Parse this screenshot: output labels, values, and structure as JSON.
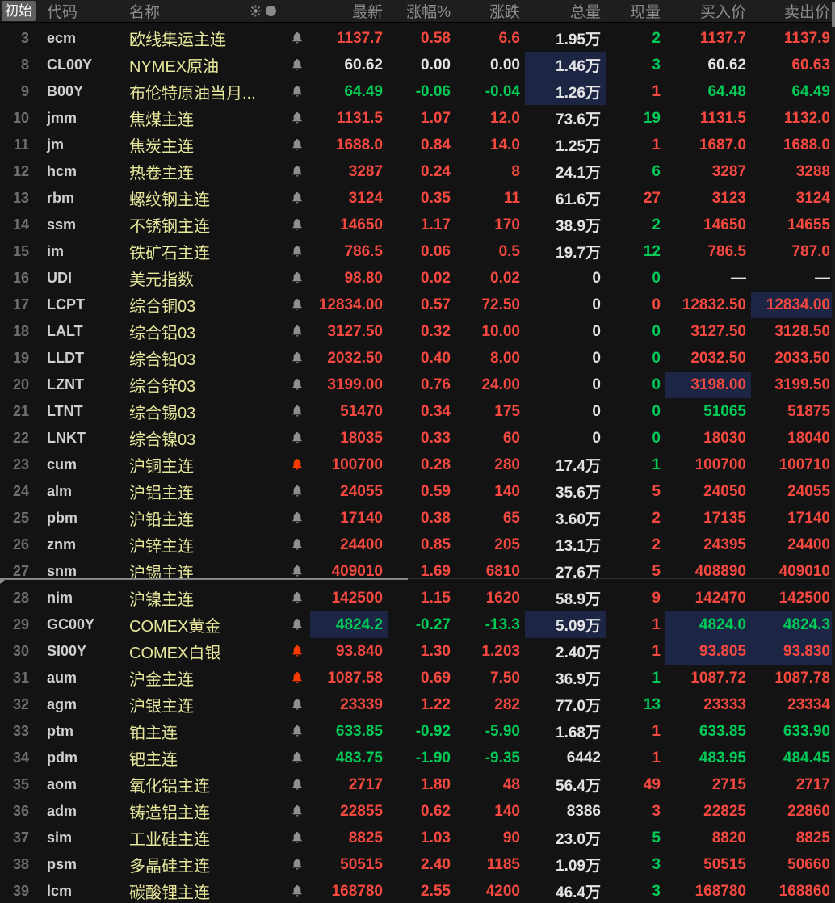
{
  "palette": {
    "red": "#f7493f",
    "green": "#00cb57",
    "white": "#e4e4e4",
    "yellow": "#e7e79c",
    "navy": "#1c2544",
    "bellgray": "#8f8f8f",
    "bellred": "#ff3a00",
    "rowbg": "#131313",
    "hdrbg": "#1e1e1e",
    "hdrtext": "#8c8c8c",
    "numgray": "#6f6f6f",
    "codegray": "#cfcfcf",
    "btnbg": "#5f5f5f"
  },
  "header": {
    "init_button": "初始",
    "code": "代码",
    "name": "名称",
    "last": "最新",
    "pct": "涨幅%",
    "chg": "涨跌",
    "vol": "总量",
    "cur": "现量",
    "bid": "买入价",
    "ask": "卖出价",
    "icons": [
      "sunburst-icon",
      "circle-icon"
    ]
  },
  "rows": [
    {
      "num": "3",
      "code": "ecm",
      "name": "欧线集运主连",
      "bell": "gray",
      "hl": [],
      "cells": [
        [
          "1137.7",
          "r"
        ],
        [
          "0.58",
          "r"
        ],
        [
          "6.6",
          "r"
        ],
        [
          "1.95万",
          "w"
        ],
        [
          "2",
          "g"
        ],
        [
          "1137.7",
          "r"
        ],
        [
          "1137.9",
          "r"
        ]
      ]
    },
    {
      "num": "8",
      "code": "CL00Y",
      "name": "NYMEX原油",
      "bell": "gray",
      "hl": [
        3
      ],
      "cells": [
        [
          "60.62",
          "w"
        ],
        [
          "0.00",
          "w"
        ],
        [
          "0.00",
          "w"
        ],
        [
          "1.46万",
          "w"
        ],
        [
          "3",
          "g"
        ],
        [
          "60.62",
          "w"
        ],
        [
          "60.63",
          "r"
        ]
      ]
    },
    {
      "num": "9",
      "code": "B00Y",
      "name": "布伦特原油当月...",
      "bell": "gray",
      "hl": [
        3
      ],
      "cells": [
        [
          "64.49",
          "g"
        ],
        [
          "-0.06",
          "g"
        ],
        [
          "-0.04",
          "g"
        ],
        [
          "1.26万",
          "w"
        ],
        [
          "1",
          "r"
        ],
        [
          "64.48",
          "g"
        ],
        [
          "64.49",
          "g"
        ]
      ]
    },
    {
      "num": "10",
      "code": "jmm",
      "name": "焦煤主连",
      "bell": "gray",
      "hl": [],
      "cells": [
        [
          "1131.5",
          "r"
        ],
        [
          "1.07",
          "r"
        ],
        [
          "12.0",
          "r"
        ],
        [
          "73.6万",
          "w"
        ],
        [
          "19",
          "g"
        ],
        [
          "1131.5",
          "r"
        ],
        [
          "1132.0",
          "r"
        ]
      ]
    },
    {
      "num": "11",
      "code": "jm",
      "name": "焦炭主连",
      "bell": "gray",
      "hl": [],
      "cells": [
        [
          "1688.0",
          "r"
        ],
        [
          "0.84",
          "r"
        ],
        [
          "14.0",
          "r"
        ],
        [
          "1.25万",
          "w"
        ],
        [
          "1",
          "r"
        ],
        [
          "1687.0",
          "r"
        ],
        [
          "1688.0",
          "r"
        ]
      ]
    },
    {
      "num": "12",
      "code": "hcm",
      "name": "热卷主连",
      "bell": "gray",
      "hl": [],
      "cells": [
        [
          "3287",
          "r"
        ],
        [
          "0.24",
          "r"
        ],
        [
          "8",
          "r"
        ],
        [
          "24.1万",
          "w"
        ],
        [
          "6",
          "g"
        ],
        [
          "3287",
          "r"
        ],
        [
          "3288",
          "r"
        ]
      ]
    },
    {
      "num": "13",
      "code": "rbm",
      "name": "螺纹钢主连",
      "bell": "gray",
      "hl": [],
      "cells": [
        [
          "3124",
          "r"
        ],
        [
          "0.35",
          "r"
        ],
        [
          "11",
          "r"
        ],
        [
          "61.6万",
          "w"
        ],
        [
          "27",
          "r"
        ],
        [
          "3123",
          "r"
        ],
        [
          "3124",
          "r"
        ]
      ]
    },
    {
      "num": "14",
      "code": "ssm",
      "name": "不锈钢主连",
      "bell": "gray",
      "hl": [],
      "cells": [
        [
          "14650",
          "r"
        ],
        [
          "1.17",
          "r"
        ],
        [
          "170",
          "r"
        ],
        [
          "38.9万",
          "w"
        ],
        [
          "2",
          "g"
        ],
        [
          "14650",
          "r"
        ],
        [
          "14655",
          "r"
        ]
      ]
    },
    {
      "num": "15",
      "code": "im",
      "name": "铁矿石主连",
      "bell": "gray",
      "hl": [],
      "cells": [
        [
          "786.5",
          "r"
        ],
        [
          "0.06",
          "r"
        ],
        [
          "0.5",
          "r"
        ],
        [
          "19.7万",
          "w"
        ],
        [
          "12",
          "g"
        ],
        [
          "786.5",
          "r"
        ],
        [
          "787.0",
          "r"
        ]
      ]
    },
    {
      "num": "16",
      "code": "UDI",
      "name": "美元指数",
      "bell": "gray",
      "hl": [],
      "cells": [
        [
          "98.80",
          "r"
        ],
        [
          "0.02",
          "r"
        ],
        [
          "0.02",
          "r"
        ],
        [
          "0",
          "w"
        ],
        [
          "0",
          "g"
        ],
        [
          "—",
          "w"
        ],
        [
          "—",
          "w"
        ]
      ]
    },
    {
      "num": "17",
      "code": "LCPT",
      "name": "综合铜03",
      "bell": "gray",
      "hl": [
        6
      ],
      "cells": [
        [
          "12834.00",
          "r"
        ],
        [
          "0.57",
          "r"
        ],
        [
          "72.50",
          "r"
        ],
        [
          "0",
          "w"
        ],
        [
          "0",
          "r"
        ],
        [
          "12832.50",
          "r"
        ],
        [
          "12834.00",
          "r"
        ]
      ]
    },
    {
      "num": "18",
      "code": "LALT",
      "name": "综合铝03",
      "bell": "gray",
      "hl": [],
      "cells": [
        [
          "3127.50",
          "r"
        ],
        [
          "0.32",
          "r"
        ],
        [
          "10.00",
          "r"
        ],
        [
          "0",
          "w"
        ],
        [
          "0",
          "g"
        ],
        [
          "3127.50",
          "r"
        ],
        [
          "3128.50",
          "r"
        ]
      ]
    },
    {
      "num": "19",
      "code": "LLDT",
      "name": "综合铅03",
      "bell": "gray",
      "hl": [],
      "cells": [
        [
          "2032.50",
          "r"
        ],
        [
          "0.40",
          "r"
        ],
        [
          "8.00",
          "r"
        ],
        [
          "0",
          "w"
        ],
        [
          "0",
          "g"
        ],
        [
          "2032.50",
          "r"
        ],
        [
          "2033.50",
          "r"
        ]
      ]
    },
    {
      "num": "20",
      "code": "LZNT",
      "name": "综合锌03",
      "bell": "gray",
      "hl": [
        5
      ],
      "cells": [
        [
          "3199.00",
          "r"
        ],
        [
          "0.76",
          "r"
        ],
        [
          "24.00",
          "r"
        ],
        [
          "0",
          "w"
        ],
        [
          "0",
          "g"
        ],
        [
          "3198.00",
          "r"
        ],
        [
          "3199.50",
          "r"
        ]
      ]
    },
    {
      "num": "21",
      "code": "LTNT",
      "name": "综合锡03",
      "bell": "gray",
      "hl": [],
      "cells": [
        [
          "51470",
          "r"
        ],
        [
          "0.34",
          "r"
        ],
        [
          "175",
          "r"
        ],
        [
          "0",
          "w"
        ],
        [
          "0",
          "g"
        ],
        [
          "51065",
          "g"
        ],
        [
          "51875",
          "r"
        ]
      ]
    },
    {
      "num": "22",
      "code": "LNKT",
      "name": "综合镍03",
      "bell": "gray",
      "hl": [],
      "cells": [
        [
          "18035",
          "r"
        ],
        [
          "0.33",
          "r"
        ],
        [
          "60",
          "r"
        ],
        [
          "0",
          "w"
        ],
        [
          "0",
          "g"
        ],
        [
          "18030",
          "r"
        ],
        [
          "18040",
          "r"
        ]
      ]
    },
    {
      "num": "23",
      "code": "cum",
      "name": "沪铜主连",
      "bell": "red",
      "hl": [],
      "cells": [
        [
          "100700",
          "r"
        ],
        [
          "0.28",
          "r"
        ],
        [
          "280",
          "r"
        ],
        [
          "17.4万",
          "w"
        ],
        [
          "1",
          "g"
        ],
        [
          "100700",
          "r"
        ],
        [
          "100710",
          "r"
        ]
      ]
    },
    {
      "num": "24",
      "code": "alm",
      "name": "沪铝主连",
      "bell": "gray",
      "hl": [],
      "cells": [
        [
          "24055",
          "r"
        ],
        [
          "0.59",
          "r"
        ],
        [
          "140",
          "r"
        ],
        [
          "35.6万",
          "w"
        ],
        [
          "5",
          "r"
        ],
        [
          "24050",
          "r"
        ],
        [
          "24055",
          "r"
        ]
      ]
    },
    {
      "num": "25",
      "code": "pbm",
      "name": "沪铅主连",
      "bell": "gray",
      "hl": [],
      "cells": [
        [
          "17140",
          "r"
        ],
        [
          "0.38",
          "r"
        ],
        [
          "65",
          "r"
        ],
        [
          "3.60万",
          "w"
        ],
        [
          "2",
          "r"
        ],
        [
          "17135",
          "r"
        ],
        [
          "17140",
          "r"
        ]
      ]
    },
    {
      "num": "26",
      "code": "znm",
      "name": "沪锌主连",
      "bell": "gray",
      "hl": [],
      "cells": [
        [
          "24400",
          "r"
        ],
        [
          "0.85",
          "r"
        ],
        [
          "205",
          "r"
        ],
        [
          "13.1万",
          "w"
        ],
        [
          "2",
          "r"
        ],
        [
          "24395",
          "r"
        ],
        [
          "24400",
          "r"
        ]
      ]
    },
    {
      "num": "27",
      "code": "snm",
      "name": "沪锡主连",
      "bell": "gray",
      "hl": [],
      "cells": [
        [
          "409010",
          "r"
        ],
        [
          "1.69",
          "r"
        ],
        [
          "6810",
          "r"
        ],
        [
          "27.6万",
          "w"
        ],
        [
          "5",
          "r"
        ],
        [
          "408890",
          "r"
        ],
        [
          "409010",
          "r"
        ]
      ]
    },
    {
      "num": "28",
      "code": "nim",
      "name": "沪镍主连",
      "bell": "gray",
      "hl": [],
      "cells": [
        [
          "142500",
          "r"
        ],
        [
          "1.15",
          "r"
        ],
        [
          "1620",
          "r"
        ],
        [
          "58.9万",
          "w"
        ],
        [
          "9",
          "r"
        ],
        [
          "142470",
          "r"
        ],
        [
          "142500",
          "r"
        ]
      ]
    },
    {
      "num": "29",
      "code": "GC00Y",
      "name": "COMEX黄金",
      "bell": "gray",
      "hl": [
        0,
        3,
        5,
        6
      ],
      "cells": [
        [
          "4824.2",
          "g"
        ],
        [
          "-0.27",
          "g"
        ],
        [
          "-13.3",
          "g"
        ],
        [
          "5.09万",
          "w"
        ],
        [
          "1",
          "r"
        ],
        [
          "4824.0",
          "g"
        ],
        [
          "4824.3",
          "g"
        ]
      ]
    },
    {
      "num": "30",
      "code": "SI00Y",
      "name": "COMEX白银",
      "bell": "red",
      "hl": [
        5,
        6
      ],
      "cells": [
        [
          "93.840",
          "r"
        ],
        [
          "1.30",
          "r"
        ],
        [
          "1.203",
          "r"
        ],
        [
          "2.40万",
          "w"
        ],
        [
          "1",
          "r"
        ],
        [
          "93.805",
          "r"
        ],
        [
          "93.830",
          "r"
        ]
      ]
    },
    {
      "num": "31",
      "code": "aum",
      "name": "沪金主连",
      "bell": "red",
      "hl": [],
      "cells": [
        [
          "1087.58",
          "r"
        ],
        [
          "0.69",
          "r"
        ],
        [
          "7.50",
          "r"
        ],
        [
          "36.9万",
          "w"
        ],
        [
          "1",
          "g"
        ],
        [
          "1087.72",
          "r"
        ],
        [
          "1087.78",
          "r"
        ]
      ]
    },
    {
      "num": "32",
      "code": "agm",
      "name": "沪银主连",
      "bell": "gray",
      "hl": [],
      "cells": [
        [
          "23339",
          "r"
        ],
        [
          "1.22",
          "r"
        ],
        [
          "282",
          "r"
        ],
        [
          "77.0万",
          "w"
        ],
        [
          "13",
          "g"
        ],
        [
          "23333",
          "r"
        ],
        [
          "23334",
          "r"
        ]
      ]
    },
    {
      "num": "33",
      "code": "ptm",
      "name": "铂主连",
      "bell": "gray",
      "hl": [],
      "cells": [
        [
          "633.85",
          "g"
        ],
        [
          "-0.92",
          "g"
        ],
        [
          "-5.90",
          "g"
        ],
        [
          "1.68万",
          "w"
        ],
        [
          "1",
          "r"
        ],
        [
          "633.85",
          "g"
        ],
        [
          "633.90",
          "g"
        ]
      ]
    },
    {
      "num": "34",
      "code": "pdm",
      "name": "钯主连",
      "bell": "gray",
      "hl": [],
      "cells": [
        [
          "483.75",
          "g"
        ],
        [
          "-1.90",
          "g"
        ],
        [
          "-9.35",
          "g"
        ],
        [
          "6442",
          "w"
        ],
        [
          "1",
          "r"
        ],
        [
          "483.95",
          "g"
        ],
        [
          "484.45",
          "g"
        ]
      ]
    },
    {
      "num": "35",
      "code": "aom",
      "name": "氧化铝主连",
      "bell": "gray",
      "hl": [],
      "cells": [
        [
          "2717",
          "r"
        ],
        [
          "1.80",
          "r"
        ],
        [
          "48",
          "r"
        ],
        [
          "56.4万",
          "w"
        ],
        [
          "49",
          "r"
        ],
        [
          "2715",
          "r"
        ],
        [
          "2717",
          "r"
        ]
      ]
    },
    {
      "num": "36",
      "code": "adm",
      "name": "铸造铝主连",
      "bell": "gray",
      "hl": [],
      "cells": [
        [
          "22855",
          "r"
        ],
        [
          "0.62",
          "r"
        ],
        [
          "140",
          "r"
        ],
        [
          "8386",
          "w"
        ],
        [
          "3",
          "r"
        ],
        [
          "22825",
          "r"
        ],
        [
          "22860",
          "r"
        ]
      ]
    },
    {
      "num": "37",
      "code": "sim",
      "name": "工业硅主连",
      "bell": "gray",
      "hl": [],
      "cells": [
        [
          "8825",
          "r"
        ],
        [
          "1.03",
          "r"
        ],
        [
          "90",
          "r"
        ],
        [
          "23.0万",
          "w"
        ],
        [
          "5",
          "g"
        ],
        [
          "8820",
          "r"
        ],
        [
          "8825",
          "r"
        ]
      ]
    },
    {
      "num": "38",
      "code": "psm",
      "name": "多晶硅主连",
      "bell": "gray",
      "hl": [],
      "cells": [
        [
          "50515",
          "r"
        ],
        [
          "2.40",
          "r"
        ],
        [
          "1185",
          "r"
        ],
        [
          "1.09万",
          "w"
        ],
        [
          "3",
          "g"
        ],
        [
          "50515",
          "r"
        ],
        [
          "50660",
          "r"
        ]
      ]
    },
    {
      "num": "39",
      "code": "lcm",
      "name": "碳酸锂主连",
      "bell": "gray",
      "hl": [],
      "cells": [
        [
          "168780",
          "r"
        ],
        [
          "2.55",
          "r"
        ],
        [
          "4200",
          "r"
        ],
        [
          "46.4万",
          "w"
        ],
        [
          "3",
          "g"
        ],
        [
          "168780",
          "r"
        ],
        [
          "168860",
          "r"
        ]
      ]
    }
  ]
}
